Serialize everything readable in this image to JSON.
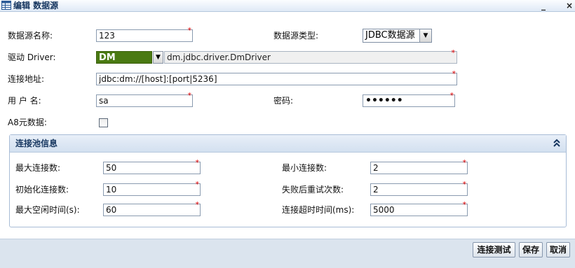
{
  "window": {
    "title": "编辑 数据源",
    "minimize_symbol": "_",
    "close_symbol": "×",
    "icon": "table-icon"
  },
  "form": {
    "name": {
      "label": "数据源名称:",
      "value": "123"
    },
    "type": {
      "label": "数据源类型:",
      "value": "JDBC数据源"
    },
    "driver": {
      "label": "驱动 Driver:",
      "value": "DM",
      "class_name": "dm.jdbc.driver.DmDriver"
    },
    "url": {
      "label": "连接地址:",
      "value": "jdbc:dm://[host]:[port|5236]"
    },
    "username": {
      "label": "用 户 名:",
      "value": "sa"
    },
    "password": {
      "label": "密码:",
      "value": "••••••"
    },
    "a8_metadata": {
      "label": "A8元数据:",
      "checked": false
    },
    "required_mark": "*"
  },
  "pool": {
    "title": "连接池信息",
    "collapse_icon": "double-chevron-up-icon",
    "max_conn": {
      "label": "最大连接数:",
      "value": "50"
    },
    "min_conn": {
      "label": "最小连接数:",
      "value": "2"
    },
    "init_conn": {
      "label": "初始化连接数:",
      "value": "10"
    },
    "retry": {
      "label": "失败后重试次数:",
      "value": "2"
    },
    "max_idle": {
      "label": "最大空闲时间(s):",
      "value": "60"
    },
    "timeout": {
      "label": "连接超时时间(ms):",
      "value": "5000"
    }
  },
  "buttons": {
    "test": "连接测试",
    "save": "保存",
    "cancel": "取消"
  },
  "colors": {
    "driver_highlight": "#4a7a12",
    "required": "#e00000",
    "title_text": "#15355f"
  }
}
